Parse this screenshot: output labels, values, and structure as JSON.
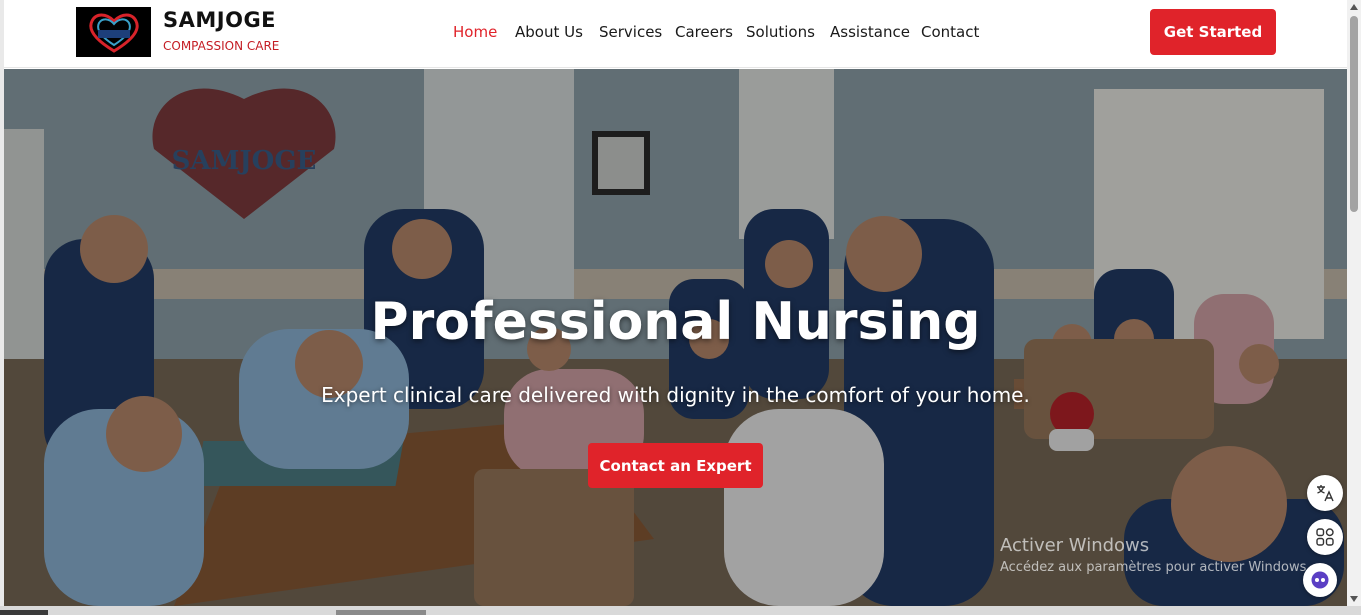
{
  "brand": {
    "name": "SAMJOGE",
    "tagline": "COMPASSION CARE"
  },
  "nav": {
    "items": [
      "Home",
      "About Us",
      "Services",
      "Careers",
      "Solutions",
      "Assistance",
      "Contact"
    ],
    "active": "Home"
  },
  "header": {
    "cta_label": "Get Started"
  },
  "hero": {
    "title": "Professional Nursing",
    "subtitle": "Expert clinical care delivered with dignity in the comfort of your home.",
    "button_label": "Contact an Expert",
    "wall_sign": "SAMJOGE"
  },
  "watermark": {
    "title": "Activer Windows",
    "subtitle": "Accédez aux paramètres pour activer Windows."
  },
  "floating_buttons": [
    "translate-icon",
    "apps-grid-icon",
    "assistant-bot-icon"
  ],
  "colors": {
    "accent": "#e0232a",
    "brand_tagline": "#c41d24",
    "text": "#1a1a1a"
  }
}
